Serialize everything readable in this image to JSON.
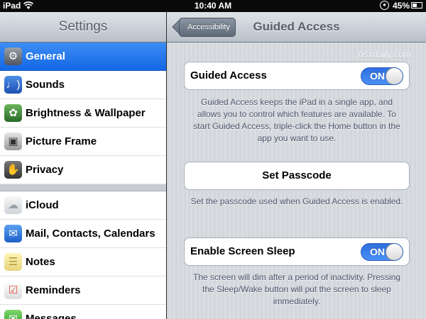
{
  "status_bar": {
    "carrier": "iPad",
    "time": "10:40 AM",
    "battery_percent": "45%"
  },
  "master": {
    "title": "Settings",
    "items": [
      {
        "label": "General",
        "icon": "gear-icon",
        "selected": true
      },
      {
        "label": "Sounds",
        "icon": "speaker-icon"
      },
      {
        "label": "Brightness & Wallpaper",
        "icon": "flower-icon"
      },
      {
        "label": "Picture Frame",
        "icon": "picture-frame-icon"
      },
      {
        "label": "Privacy",
        "icon": "hand-icon"
      },
      {
        "label": "iCloud",
        "icon": "cloud-icon"
      },
      {
        "label": "Mail, Contacts, Calendars",
        "icon": "envelope-icon"
      },
      {
        "label": "Notes",
        "icon": "notepad-icon"
      },
      {
        "label": "Reminders",
        "icon": "checklist-icon"
      },
      {
        "label": "Messages",
        "icon": "speech-bubble-icon"
      }
    ]
  },
  "detail": {
    "back_label": "Accessibility",
    "title": "Guided Access",
    "watermark": "osxdaily.com",
    "guided_access": {
      "label": "Guided Access",
      "toggle": "ON",
      "footer": "Guided Access keeps the iPad in a single app, and allows you to control which features are available. To start Guided Access, triple-click the Home button in the app you want to use."
    },
    "set_passcode": {
      "label": "Set Passcode",
      "footer": "Set the passcode used when Guided Access is enabled."
    },
    "screen_sleep": {
      "label": "Enable Screen Sleep",
      "toggle": "ON",
      "footer": "The screen will dim after a period of inactivity. Pressing the Sleep/Wake button will put the screen to sleep immediately."
    }
  },
  "colors": {
    "selection_blue": "#1467e4",
    "toggle_blue": "#3b7fe8",
    "navbar_text": "#57606c",
    "group_background": "#d6d9de"
  }
}
